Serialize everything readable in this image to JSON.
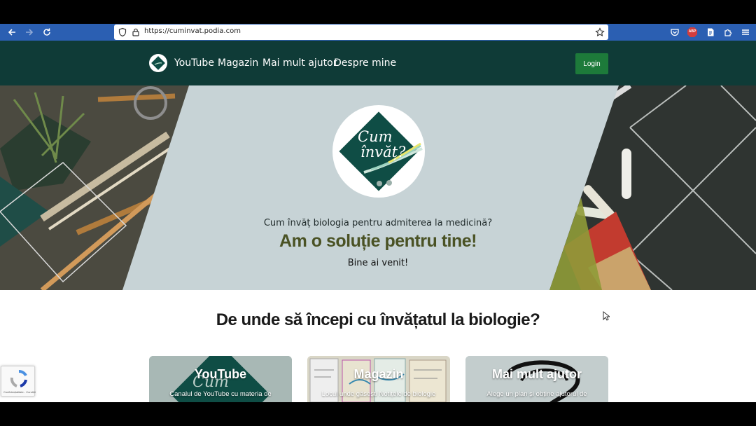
{
  "browser": {
    "url": "https://cuminvat.podia.com",
    "extension_badge": "ABP"
  },
  "nav": {
    "links": [
      "YouTube",
      "Magazin",
      "Mai mult ajutor",
      "Despre mine"
    ],
    "login_label": "Login"
  },
  "hero": {
    "logo_line1": "Cum",
    "logo_line2": "învăț?",
    "subtitle": "Cum învăț biologia pentru admiterea la medicină?",
    "headline": "Am o soluție pentru tine!",
    "welcome": "Bine ai venit!"
  },
  "section": {
    "title": "De unde să începi cu învățatul la biologie?",
    "cards": [
      {
        "title": "YouTube",
        "desc": "Canalul de YouTube cu materia de"
      },
      {
        "title": "Magazin",
        "desc": "Locul unde găsești Notițele de biologie"
      },
      {
        "title": "Mai mult ajutor",
        "desc": "Alege un plan și obține ajutorul de"
      }
    ]
  },
  "recaptcha": {
    "footer": "Confidențialitate - Condiții"
  },
  "colors": {
    "toolbar": "#2b5fb2",
    "nav_bg": "#0f3b37",
    "login_bg": "#1d7a3a",
    "hero_panel": "#c7d3d6",
    "headline": "#4a5224"
  }
}
